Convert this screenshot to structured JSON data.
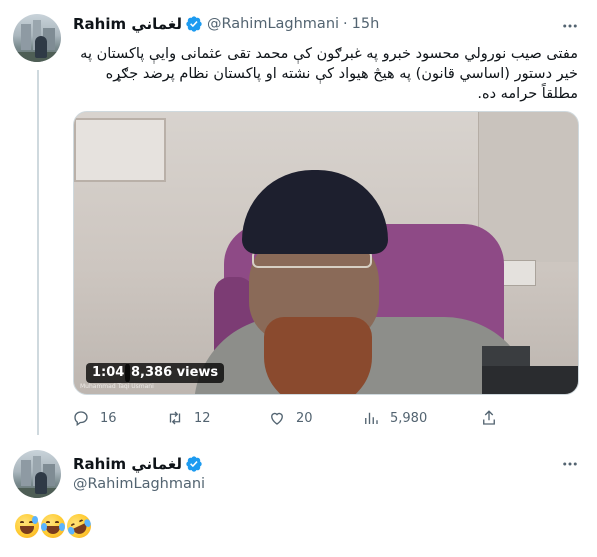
{
  "tweet1": {
    "display_name": "Rahim لغماني",
    "handle": "@RahimLaghmani",
    "separator": "·",
    "time": "15h",
    "text": "مفتی صیب نورولي محسود خبرو په غبرګون کې محمد تقی عثمانی وایې پاکستان په خير دستور (اساسي قانون) په هيڅ هيواد کې نشته او پاکستان نظام پرضد جګړه مطلقاً حرامه ده.",
    "video": {
      "duration": "1:04",
      "views": "8,386 views",
      "watermark": "Muhammad Taqi Usmani"
    },
    "actions": {
      "replies": "16",
      "retweets": "12",
      "likes": "20",
      "views": "5,980"
    }
  },
  "tweet2": {
    "display_name": "Rahim لغماني",
    "handle": "@RahimLaghmani"
  },
  "icons": {
    "verified": "verified-badge-icon",
    "more": "more-dots-icon",
    "reply": "reply-icon",
    "retweet": "retweet-icon",
    "like": "heart-icon",
    "views": "views-chart-icon",
    "share": "share-icon"
  },
  "colors": {
    "text": "#0f1419",
    "secondary": "#536471",
    "verified": "#1d9bf0",
    "border": "#cfd9de"
  }
}
